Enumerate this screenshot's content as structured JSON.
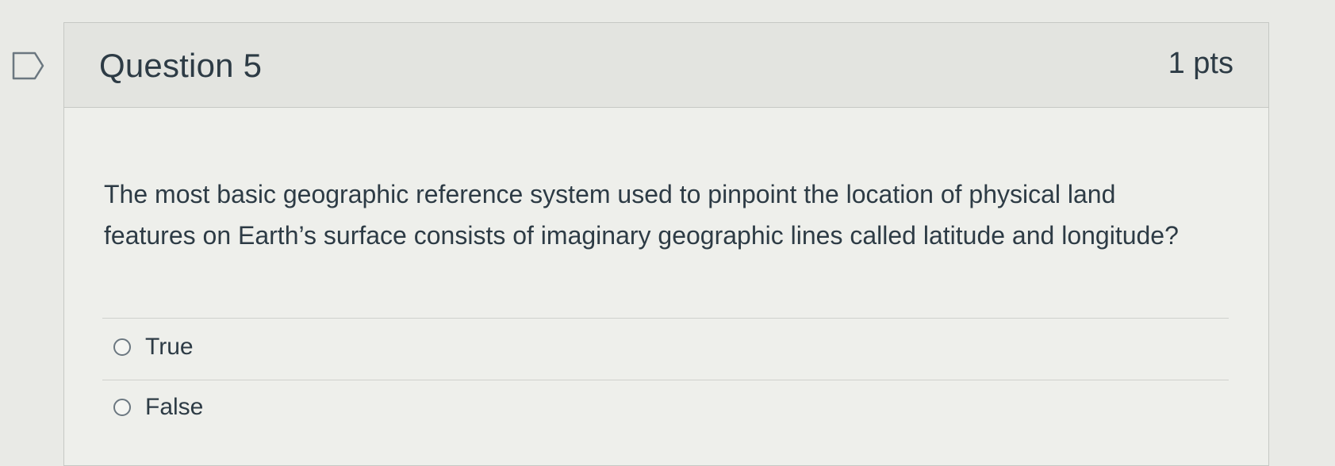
{
  "question": {
    "title": "Question 5",
    "points": "1 pts",
    "text": "The most basic geographic reference system used to pinpoint the location of physical land features on Earth’s surface consists of imaginary geographic lines called latitude and longitude?",
    "flag_icon": "bookmark-flag-icon",
    "answers": [
      {
        "label": "True",
        "selected": false
      },
      {
        "label": "False",
        "selected": false
      }
    ]
  }
}
